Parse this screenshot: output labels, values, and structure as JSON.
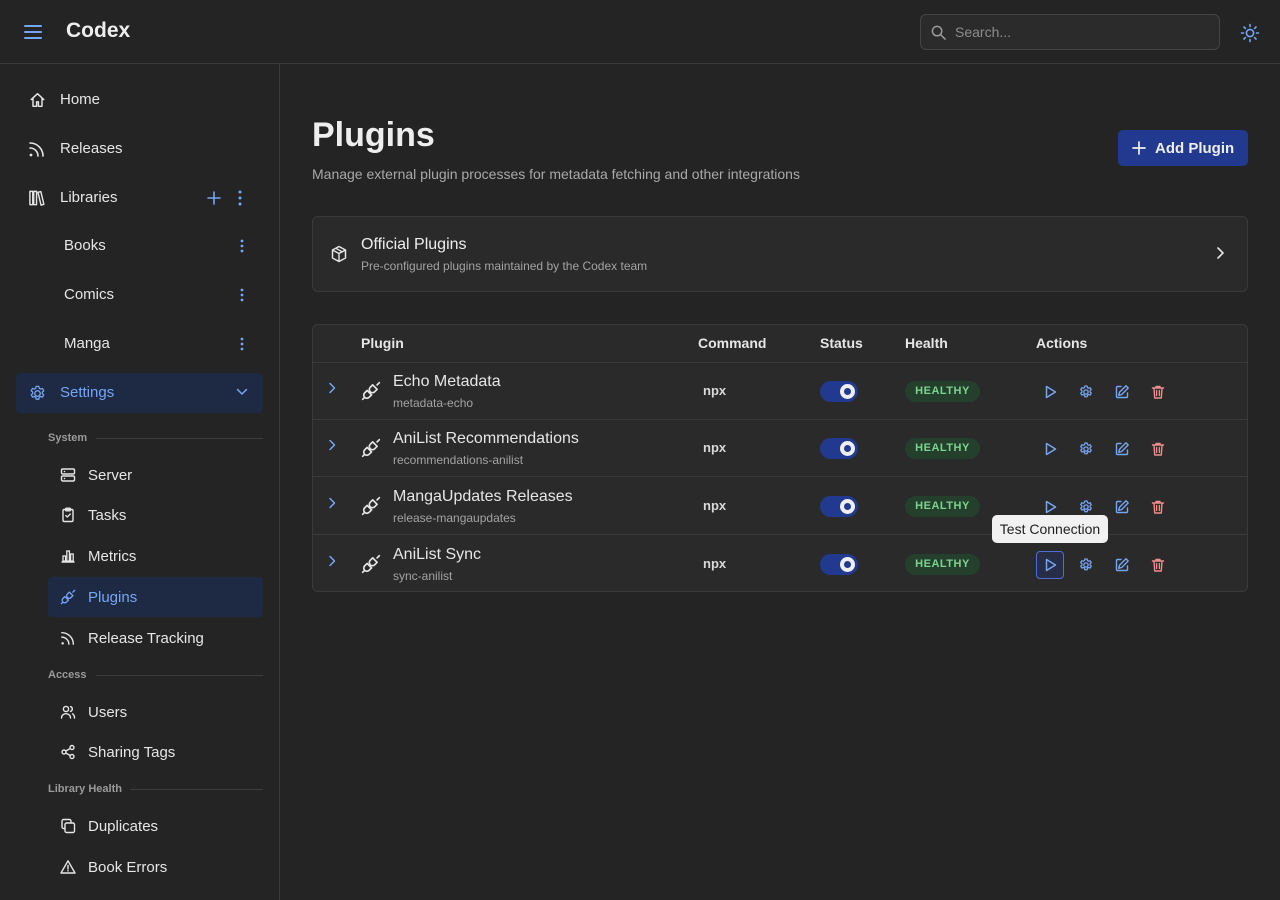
{
  "header": {
    "app_title": "Codex",
    "search_placeholder": "Search..."
  },
  "sidebar": {
    "home": "Home",
    "releases": "Releases",
    "libraries": "Libraries",
    "library_items": [
      "Books",
      "Comics",
      "Manga"
    ],
    "settings": "Settings",
    "sections": {
      "system": "System",
      "access": "Access",
      "library_health": "Library Health"
    },
    "system_items": [
      "Server",
      "Tasks",
      "Metrics",
      "Plugins",
      "Release Tracking"
    ],
    "access_items": [
      "Users",
      "Sharing Tags"
    ],
    "health_items": [
      "Duplicates",
      "Book Errors"
    ]
  },
  "main": {
    "title": "Plugins",
    "subtitle": "Manage external plugin processes for metadata fetching and other integrations",
    "add_button": "Add Plugin",
    "official": {
      "title": "Official Plugins",
      "description": "Pre-configured plugins maintained by the Codex team"
    },
    "table": {
      "headers": [
        "Plugin",
        "Command",
        "Status",
        "Health",
        "Actions"
      ],
      "rows": [
        {
          "name": "Echo Metadata",
          "id": "metadata-echo",
          "command": "npx",
          "enabled": true,
          "health": "HEALTHY"
        },
        {
          "name": "AniList Recommendations",
          "id": "recommendations-anilist",
          "command": "npx",
          "enabled": true,
          "health": "HEALTHY"
        },
        {
          "name": "MangaUpdates Releases",
          "id": "release-mangaupdates",
          "command": "npx",
          "enabled": true,
          "health": "HEALTHY"
        },
        {
          "name": "AniList Sync",
          "id": "sync-anilist",
          "command": "npx",
          "enabled": true,
          "health": "HEALTHY"
        }
      ]
    },
    "tooltip": "Test Connection"
  },
  "colors": {
    "accent": "#74a6f6",
    "primary_button": "#213a8f",
    "healthy_text": "#7bd38e",
    "healthy_bg": "#24402d",
    "danger": "#f08c8c"
  }
}
